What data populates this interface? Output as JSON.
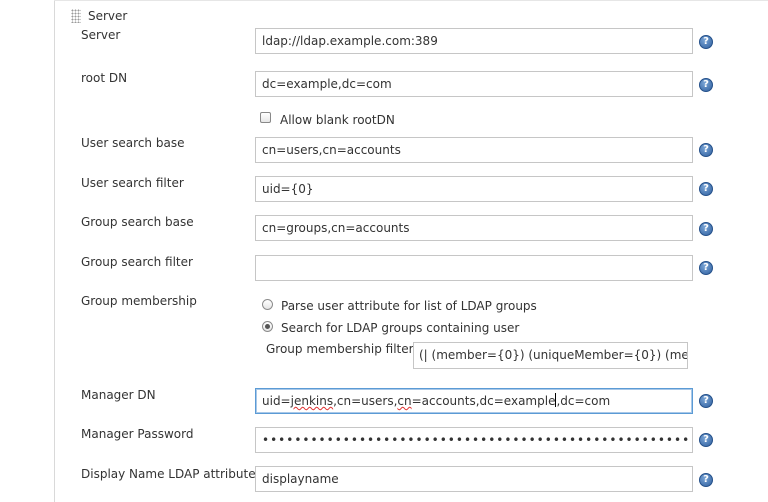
{
  "section": {
    "title": "Server"
  },
  "fields": {
    "server": {
      "label": "Server",
      "value": "ldap://ldap.example.com:389"
    },
    "root_dn": {
      "label": "root DN",
      "value": "dc=example,dc=com"
    },
    "allow_blank": {
      "label": "Allow blank rootDN",
      "checked": false
    },
    "user_search_base": {
      "label": "User search base",
      "value": "cn=users,cn=accounts"
    },
    "user_search_filter": {
      "label": "User search filter",
      "value": "uid={0}"
    },
    "group_search_base": {
      "label": "Group search base",
      "value": "cn=groups,cn=accounts"
    },
    "group_search_filter": {
      "label": "Group search filter",
      "value": ""
    },
    "group_membership": {
      "label": "Group membership",
      "options": [
        {
          "label": "Parse user attribute for list of LDAP groups",
          "selected": false
        },
        {
          "label": "Search for LDAP groups containing user",
          "selected": true
        }
      ],
      "filter_label": "Group membership filter",
      "filter_value": "(| (member={0}) (uniqueMember={0}) (me"
    },
    "manager_dn": {
      "label": "Manager DN",
      "value_parts": [
        "uid=",
        "jenkins",
        ",cn=users,",
        "cn",
        "=accounts,dc=example",
        ",dc=com"
      ]
    },
    "manager_password": {
      "label": "Manager Password",
      "value": "•••••••••••••••••••••••••••••••••••••••••••••••••••••"
    },
    "display_name_attr": {
      "label": "Display Name LDAP attribute",
      "value": "displayname"
    }
  },
  "help_icon": {
    "glyph": "?",
    "color": "#2f5f9e"
  }
}
